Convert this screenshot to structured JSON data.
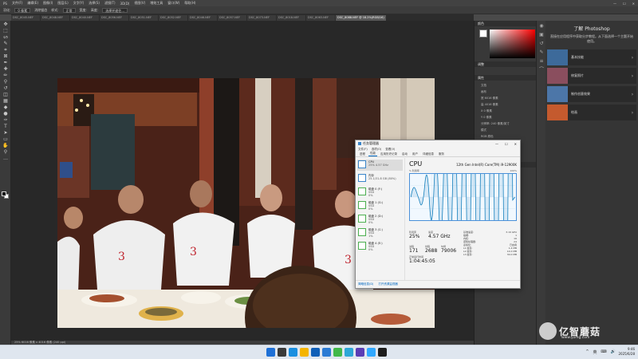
{
  "ps": {
    "menu": [
      "PS",
      "文件(F)",
      "编辑(E)",
      "图像(I)",
      "图层(L)",
      "文字(Y)",
      "选择(S)",
      "滤镜(T)",
      "3D(D)",
      "视图(V)",
      "增效工具",
      "窗口(W)",
      "帮助(H)"
    ],
    "window_controls": [
      "—",
      "☐",
      "✕"
    ],
    "options": [
      "羽化:",
      "0 像素",
      "消除锯齿",
      "样式:",
      "正常",
      "宽度:",
      "高度:",
      "选择并遮住..."
    ],
    "tabs": [
      "DSC_8045.NEF",
      "DSC_8048.NEF",
      "DSC_8040.NEF",
      "DSC_8056.NEF",
      "DSC_8051.NEF",
      "DSC_8052.NEF",
      "DSC_8046.NEF",
      "DSC_8057.NEF",
      "DSC_8073.NEF",
      "DSC_8018.NEF",
      "DSC_8063.NEF",
      "DSC_8088.NEF @ 18.2%(RGB/16)"
    ],
    "status_text": "25%    6016 像素 x 4016 像素 (240 ppi)",
    "panels": {
      "color_title": "颜色",
      "adjust_title": "调整",
      "props_title": "属性",
      "layers_title": "图层",
      "props_rows": [
        "文档",
        "画布",
        "宽 6016 像素",
        "高 4016 像素",
        "X 0 像素",
        "Y 0 像素",
        "分辨率: 240 像素/英寸",
        "模式",
        "RGB 颜色",
        "16 位/通道",
        "填充",
        "标尺和网格"
      ]
    }
  },
  "learn": {
    "title": "了解 Photoshop",
    "desc": "直接在应用程序中获取分步教程。从下面选择一个主题开始使用。",
    "cards": [
      {
        "label": "基本技能",
        "color": "#3d6a9a"
      },
      {
        "label": "修复照片",
        "color": "#8a4e5e"
      },
      {
        "label": "制作创意效果",
        "color": "#4c76a8"
      },
      {
        "label": "绘画",
        "color": "#c45a2e"
      }
    ],
    "arrow": "›"
  },
  "watermark": {
    "brand": "亿智蘑菇",
    "url": "www.yzmg.com"
  },
  "taskmgr": {
    "title": "任务管理器",
    "controls": [
      "—",
      "☐",
      "✕"
    ],
    "menu": [
      "文件(F)",
      "选项(O)",
      "查看(V)"
    ],
    "tabs": [
      "进程",
      "性能",
      "应用历史记录",
      "启动",
      "用户",
      "详细信息",
      "服务"
    ],
    "side": [
      {
        "name": "CPU",
        "sub": "25%  4.57 GHz",
        "kind": "cpu"
      },
      {
        "name": "内存",
        "sub": "25.1/31.8 GB (80%)",
        "kind": "cpu"
      },
      {
        "name": "磁盘 0 (F:)",
        "sub": "SSD\n0%",
        "kind": "disk"
      },
      {
        "name": "磁盘 1 (G:)",
        "sub": "SSD\n0%",
        "kind": "disk"
      },
      {
        "name": "磁盘 2 (D:)",
        "sub": "SSD\n0%",
        "kind": "disk"
      },
      {
        "name": "磁盘 3 (C:)",
        "sub": "SSD\n1%",
        "kind": "disk"
      },
      {
        "name": "磁盘 4 (E:)",
        "sub": "SSD\n0%",
        "kind": "disk"
      }
    ],
    "main": {
      "heading": "CPU",
      "model": "12th Gen Intel(R) Core(TM) i9-12900K",
      "axis_label": "% 利用率",
      "axis_max": "100%",
      "utilization_label": "利用率",
      "speed_label": "速度",
      "utilization": "25%",
      "speed": "4.57 GHz",
      "processes_label": "进程",
      "threads_label": "线程",
      "handles_label": "句柄",
      "processes": "171",
      "threads": "2688",
      "handles": "79006",
      "uptime_label": "正常运行时间",
      "uptime": "1:04:45:05",
      "kv": [
        [
          "基准速度:",
          "3.19 GHz"
        ],
        [
          "插槽:",
          "1"
        ],
        [
          "内核:",
          "16"
        ],
        [
          "逻辑处理器:",
          "24"
        ],
        [
          "虚拟化:",
          "已启用"
        ],
        [
          "L1 缓存:",
          "1.4 MB"
        ],
        [
          "L2 缓存:",
          "14.0 MB"
        ],
        [
          "L3 缓存:",
          "30.0 MB"
        ]
      ]
    },
    "footer": [
      "简略信息(D)",
      "打开资源监视器"
    ]
  },
  "taskbar": {
    "apps": [
      "#1e70d6",
      "#3a3a3a",
      "#1a8fe0",
      "#f4b400",
      "#0f5fb8",
      "#2b7bd4",
      "#41b84a",
      "#2da7d8",
      "#5a3db5",
      "#31a8ff",
      "#1d1d1d"
    ],
    "time": "9:46",
    "date": "2025/6/28",
    "tray": [
      "^",
      "英",
      "⌨",
      "🔊"
    ]
  }
}
